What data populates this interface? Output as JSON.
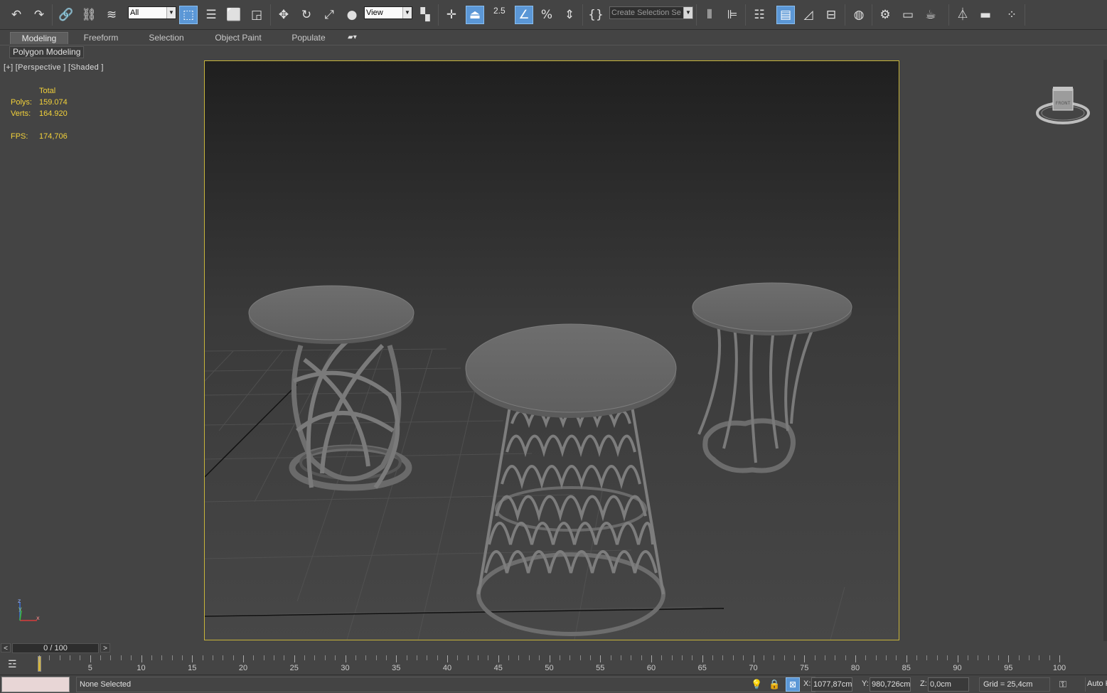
{
  "toolbar": {
    "selection_filter": "All",
    "reference_coord": "View",
    "snap_angle": "2.5",
    "named_selection_placeholder": "Create Selection Se"
  },
  "ribbon": {
    "tabs": [
      "Modeling",
      "Freeform",
      "Selection",
      "Object Paint",
      "Populate"
    ],
    "active_tab": "Modeling",
    "sub_tab": "Polygon Modeling"
  },
  "viewport": {
    "label": "[+] [Perspective ] [Shaded ]",
    "stats": {
      "header": "Total",
      "polys_label": "Polys:",
      "polys_value": "159.074",
      "verts_label": "Verts:",
      "verts_value": "164.920",
      "fps_label": "FPS:",
      "fps_value": "174,706"
    },
    "viewcube_label": "FRONT",
    "axis": {
      "x": "x",
      "y": "y",
      "z": "z"
    }
  },
  "timeline": {
    "frame_display": "0 / 100",
    "prev": "<",
    "next": ">",
    "ticks": [
      "0",
      "5",
      "10",
      "15",
      "20",
      "25",
      "30",
      "35",
      "40",
      "45",
      "50",
      "55",
      "60",
      "65",
      "70",
      "75",
      "80",
      "85",
      "90",
      "95",
      "100"
    ]
  },
  "status": {
    "selection_text": "None Selected",
    "x_label": "X:",
    "x_value": "1077,87cm",
    "y_label": "Y:",
    "y_value": "980,726cm",
    "z_label": "Z:",
    "z_value": "0,0cm",
    "grid": "Grid = 25,4cm",
    "auto_key": "Auto K"
  },
  "colors": {
    "accent_blue": "#5b97d6",
    "viewport_border": "#c8b53a",
    "stats_text": "#f2d13a"
  }
}
